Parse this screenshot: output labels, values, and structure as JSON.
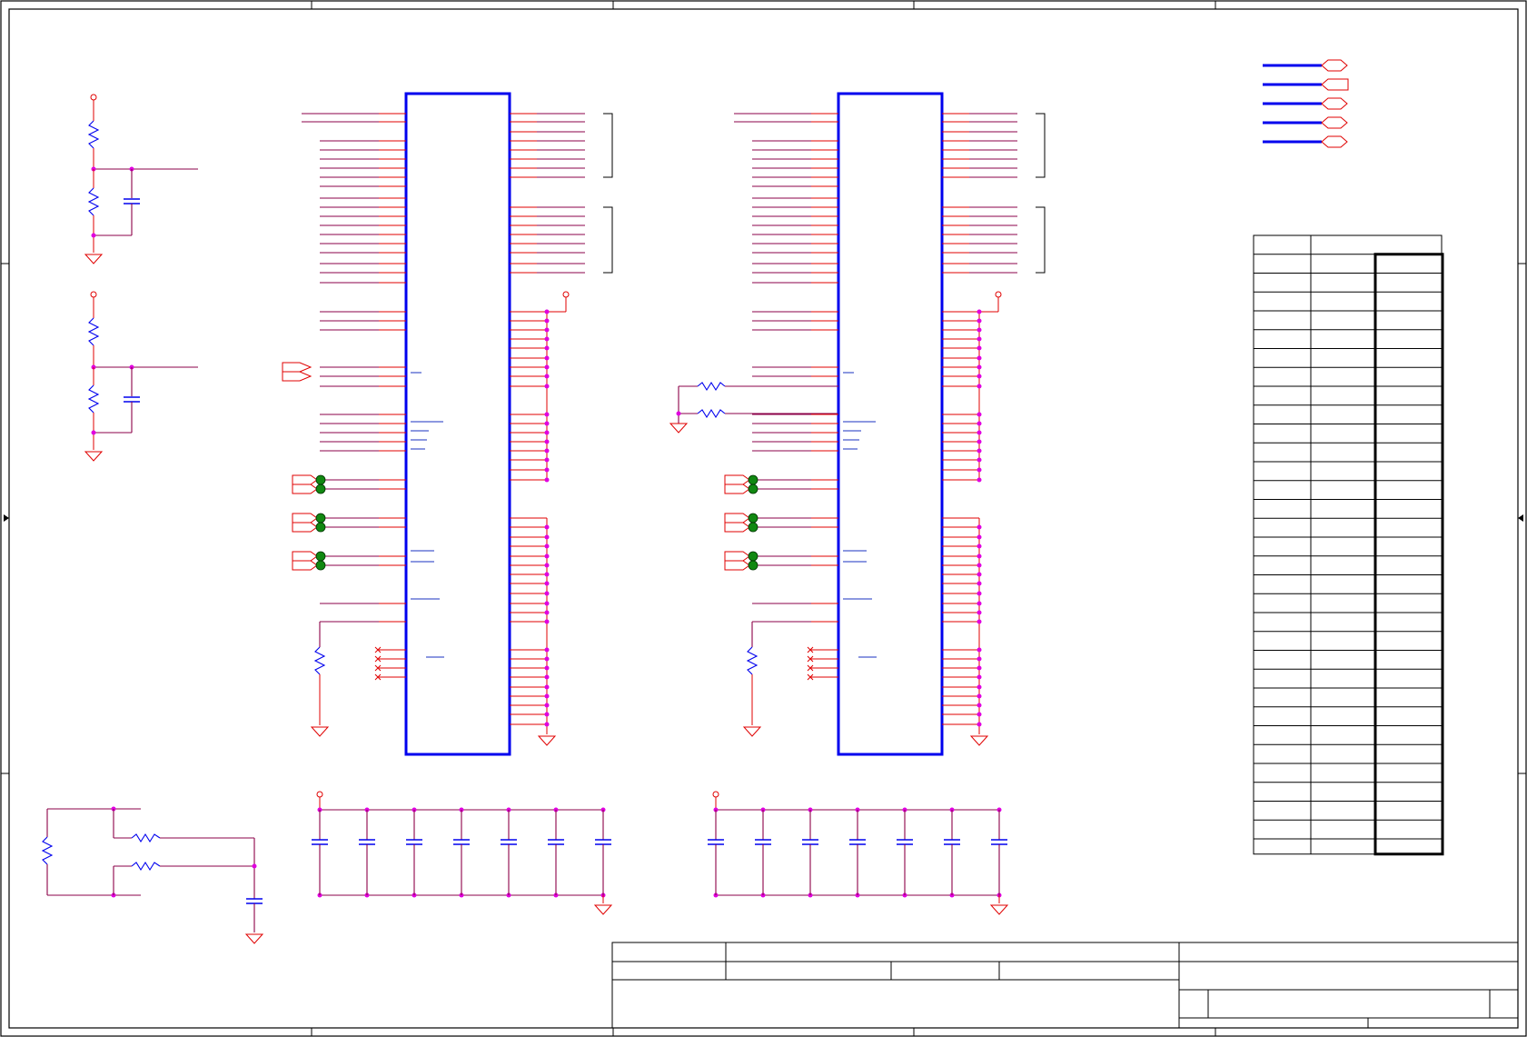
{
  "sheet": {
    "type": "schematic",
    "background": "#ffffff",
    "frame_color": "#000000",
    "ic_outline_color": "#0000ee",
    "pin_color": "#e00000",
    "net_wire_color": "#8b0048",
    "junction_color": "#e000e0",
    "test_point_color": "#118811",
    "text_labels": []
  },
  "components": {
    "ic_count": 2,
    "legend_port_symbols": [
      "bidirectional-port",
      "output-port",
      "bidirectional-port",
      "bidirectional-port",
      "bidirectional-port"
    ],
    "pin_table_rows": 32,
    "pin_table_columns": 3
  }
}
